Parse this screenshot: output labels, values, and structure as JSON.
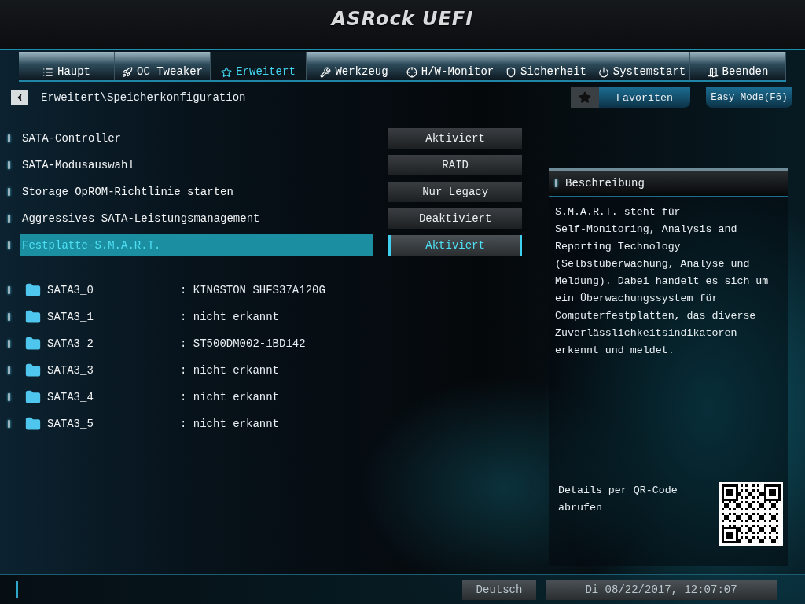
{
  "header": {
    "logo": "ASRock UEFI"
  },
  "tabs": [
    {
      "label": "Haupt",
      "selected": false
    },
    {
      "label": "OC Tweaker",
      "selected": false
    },
    {
      "label": "Erweitert",
      "selected": true
    },
    {
      "label": "Werkzeug",
      "selected": false
    },
    {
      "label": "H/W-Monitor",
      "selected": false
    },
    {
      "label": "Sicherheit",
      "selected": false
    },
    {
      "label": "Systemstart",
      "selected": false
    },
    {
      "label": "Beenden",
      "selected": false
    }
  ],
  "breadcrumb": "Erweitert\\Speicherkonfiguration",
  "favorites_button": "Favoriten",
  "easy_mode_button": "Easy Mode(F6)",
  "settings": [
    {
      "kind": "setting",
      "label": "SATA-Controller",
      "value": "Aktiviert",
      "selected": false
    },
    {
      "kind": "setting",
      "label": "SATA-Modusauswahl",
      "value": "RAID",
      "selected": false
    },
    {
      "kind": "setting",
      "label": "Storage OpROM-Richtlinie starten",
      "value": "Nur Legacy",
      "selected": false
    },
    {
      "kind": "setting",
      "label": "Aggressives SATA-Leistungsmanagement",
      "value": "Deaktiviert",
      "selected": false
    },
    {
      "kind": "setting",
      "label": "Festplatte-S.M.A.R.T.",
      "value": "Aktiviert",
      "selected": true
    },
    {
      "kind": "spacer"
    },
    {
      "kind": "drive",
      "label": "SATA3_0",
      "value": ": KINGSTON SHFS37A120G",
      "selected": false
    },
    {
      "kind": "drive",
      "label": "SATA3_1",
      "value": ": nicht erkannt",
      "selected": false
    },
    {
      "kind": "drive",
      "label": "SATA3_2",
      "value": ": ST500DM002-1BD142",
      "selected": false
    },
    {
      "kind": "drive",
      "label": "SATA3_3",
      "value": ": nicht erkannt",
      "selected": false
    },
    {
      "kind": "drive",
      "label": "SATA3_4",
      "value": ": nicht erkannt",
      "selected": false
    },
    {
      "kind": "drive",
      "label": "SATA3_5",
      "value": ": nicht erkannt",
      "selected": false
    }
  ],
  "description": {
    "title": "Beschreibung",
    "text": "S.M.A.R.T. steht für\nSelf-Monitoring, Analysis and\nReporting Technology\n(Selbstüberwachung, Analyse und\nMeldung). Dabei handelt es sich um\nein Überwachungssystem für\nComputerfestplatten, das diverse\nZuverlässlichkeitsindikatoren\nerkennt und meldet.",
    "qr_caption": "Details per QR-Code\nabrufen"
  },
  "status_bar": {
    "language": "Deutsch",
    "datetime": "Di 08/22/2017, 12:07:07"
  }
}
